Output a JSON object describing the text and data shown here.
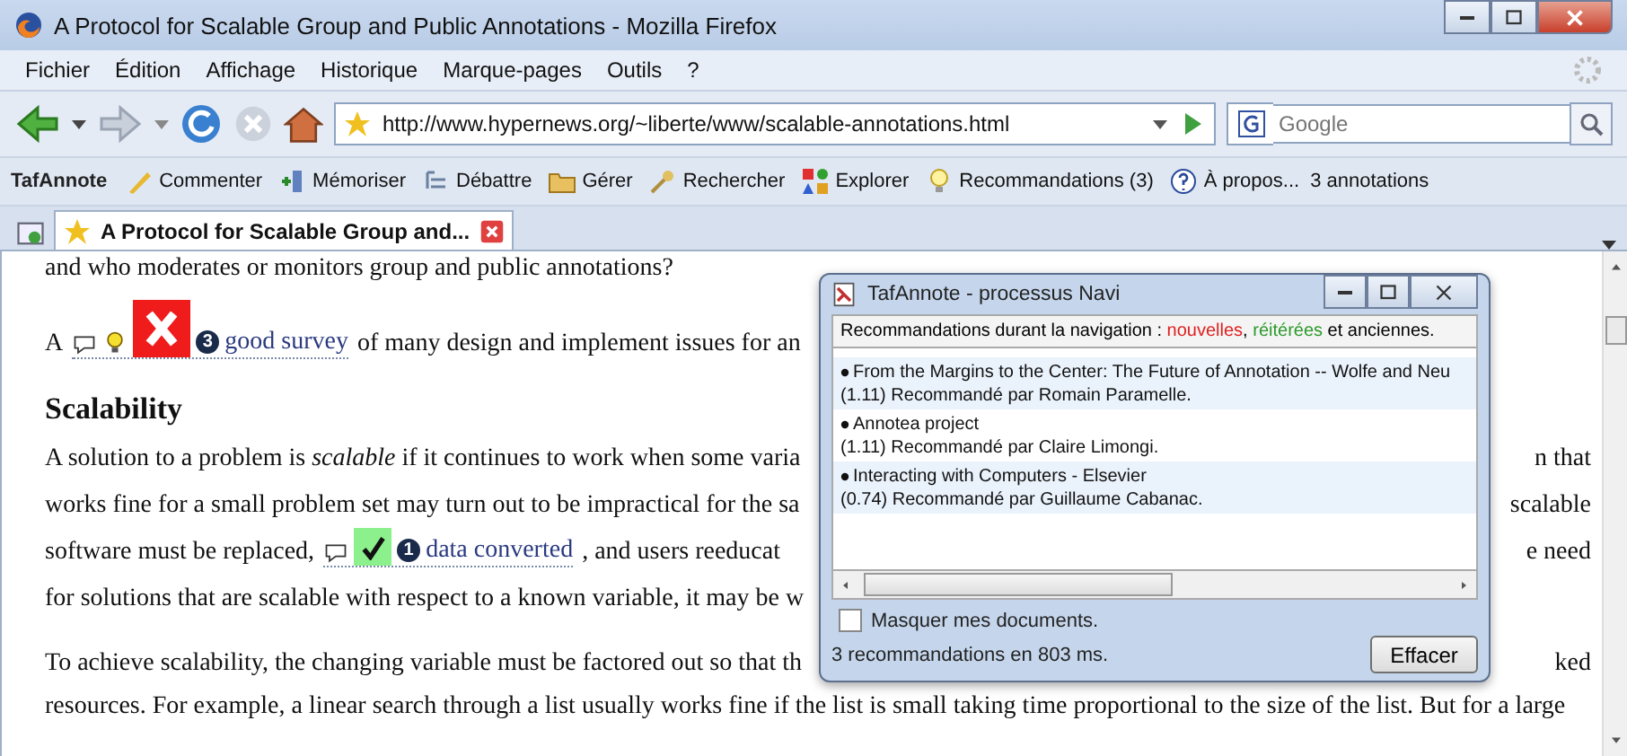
{
  "window": {
    "title": "A Protocol for Scalable Group and Public Annotations - Mozilla Firefox"
  },
  "menu": [
    "Fichier",
    "Édition",
    "Affichage",
    "Historique",
    "Marque-pages",
    "Outils",
    "?"
  ],
  "navigation": {
    "url": "http://www.hypernews.org/~liberte/www/scalable-annotations.html",
    "search_placeholder": "Google"
  },
  "toolbar": {
    "label": "TafAnnote",
    "items": [
      {
        "kind": "comment",
        "label": "Commenter"
      },
      {
        "kind": "memorize",
        "label": "Mémoriser"
      },
      {
        "kind": "debate",
        "label": "Débattre"
      },
      {
        "kind": "manage",
        "label": "Gérer"
      },
      {
        "kind": "search",
        "label": "Rechercher"
      },
      {
        "kind": "explore",
        "label": "Explorer"
      },
      {
        "kind": "recommend",
        "label": "Recommandations (3)"
      },
      {
        "kind": "about",
        "label": "À propos..."
      }
    ],
    "count": "3 annotations"
  },
  "tabs": [
    {
      "label": "A Protocol for Scalable Group and...",
      "selected": true
    }
  ],
  "page": {
    "lines": [
      {
        "kind": "text",
        "left": "and who moderates or monitors group and public annotations?"
      },
      {
        "kind": "annotated",
        "before": "A",
        "annotation": {
          "kind": "rejected",
          "number": "3",
          "link": "good survey"
        },
        "after": "of many design and implement issues for an"
      },
      {
        "kind": "heading",
        "left": "Scalability"
      },
      {
        "kind": "text",
        "left": "A solution to a problem is *scalable* if it continues to work when some varia",
        "right": "n that"
      },
      {
        "kind": "text",
        "left": "works fine for a small problem set may turn out to be impractical for the sa",
        "right": "scalable"
      },
      {
        "kind": "annotated",
        "before": "software must be replaced,",
        "annotation": {
          "kind": "approved",
          "number": "1",
          "link": "data converted"
        },
        "after": ", and users reeducat",
        "right": "e need"
      },
      {
        "kind": "text",
        "left": "for solutions that are scalable with respect to a known variable, it may be w"
      },
      {
        "kind": "gap"
      },
      {
        "kind": "text",
        "left": "To achieve scalability, the changing variable must be factored out so that th",
        "right": "ked"
      },
      {
        "kind": "text",
        "left": "resources. For example, a linear search through a list usually works fine if the list is small taking time proportional to the size of the list. But for a large"
      }
    ]
  },
  "popup": {
    "title": "TafAnnote - processus Navi",
    "legend": [
      {
        "text": "Recommandations durant la navigation : "
      },
      {
        "text": "nouvelles",
        "color": "#e02020"
      },
      {
        "text": ", "
      },
      {
        "text": "réitérées",
        "color": "#2a9a2a"
      },
      {
        "text": " et anciennes."
      }
    ],
    "items": [
      {
        "title": "From the Margins to the Center: The Future of Annotation -- Wolfe and Neu",
        "detail": "(1.11) Recommandé par Romain Paramelle."
      },
      {
        "title": "Annotea project",
        "detail": "(1.11) Recommandé par Claire Limongi."
      },
      {
        "title": "Interacting with Computers - Elsevier",
        "detail": "(0.74) Recommandé par Guillaume Cabanac."
      }
    ],
    "hide_mine": {
      "label": "Masquer mes documents.",
      "checked": false
    },
    "status": "3 recommandations en 803 ms.",
    "button": "Effacer"
  }
}
